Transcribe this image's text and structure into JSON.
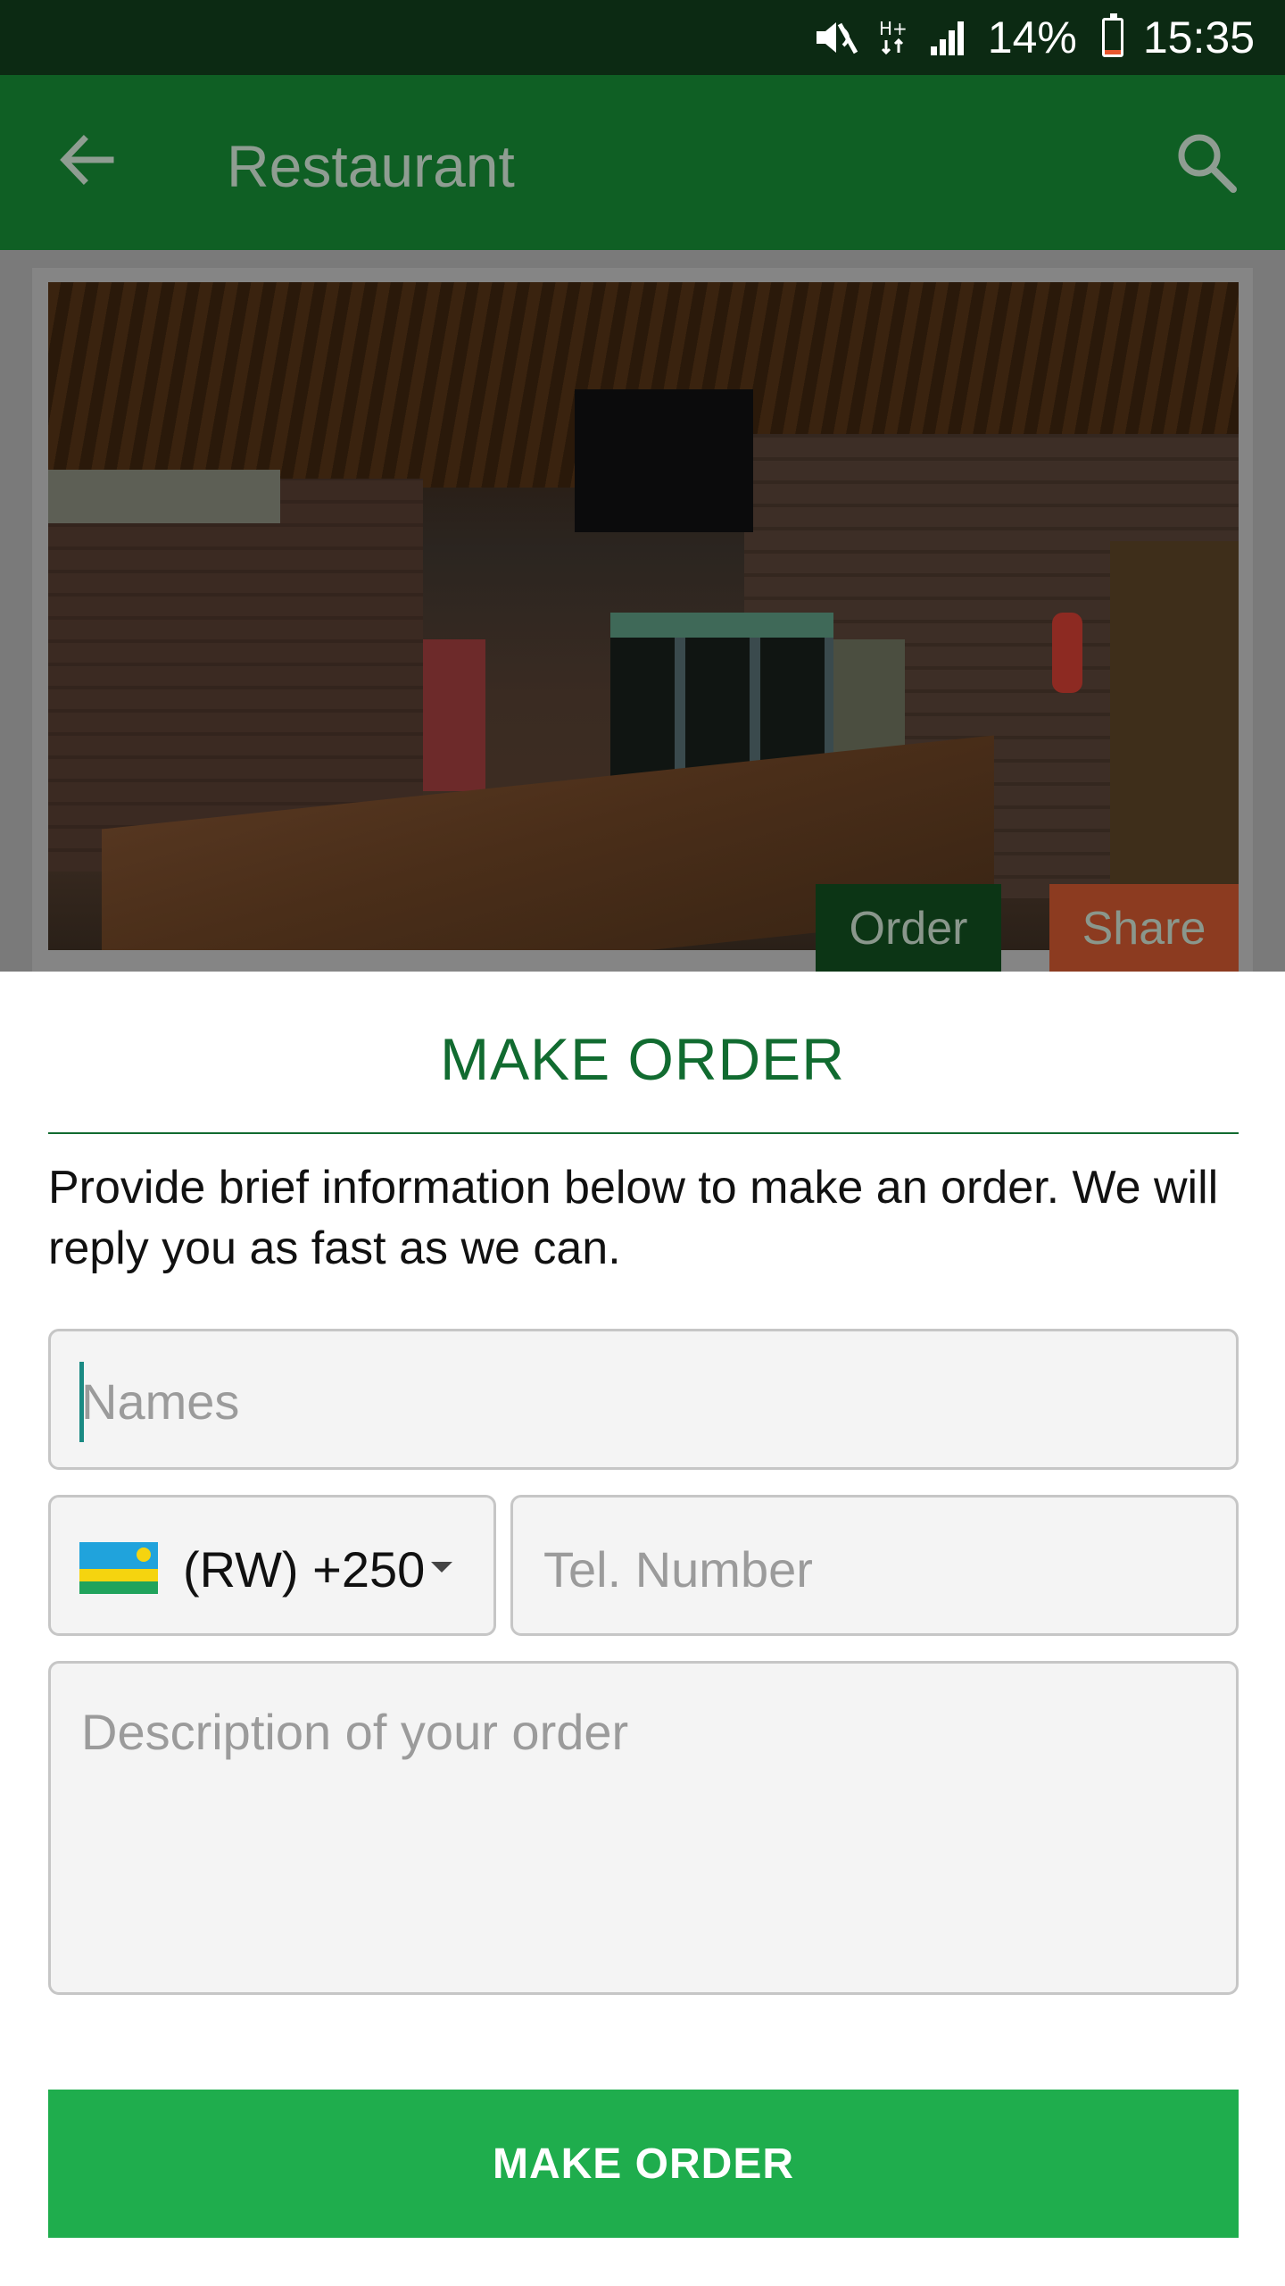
{
  "status_bar": {
    "battery_percent": "14%",
    "battery_level": 0.14,
    "time": "15:35",
    "icons": [
      "mute-icon",
      "network-hplus-icon",
      "signal-icon",
      "battery-icon"
    ]
  },
  "app_bar": {
    "title": "Restaurant",
    "back_icon": "arrow-left-icon",
    "search_icon": "search-icon"
  },
  "card": {
    "order_label": "Order",
    "share_label": "Share"
  },
  "sheet": {
    "title": "MAKE ORDER",
    "intro": "Provide brief information below to make an order. We will reply you as fast as we can.",
    "names_placeholder": "Names",
    "country_code": "(RW) +250",
    "tel_placeholder": "Tel. Number",
    "description_placeholder": "Description of your order",
    "submit_label": "MAKE ORDER"
  },
  "colors": {
    "status_bar": "#0c2a13",
    "app_bar": "#0f5f24",
    "title_green": "#116b30",
    "button_green": "#1fad4d",
    "share_orange": "#8c3b20"
  }
}
